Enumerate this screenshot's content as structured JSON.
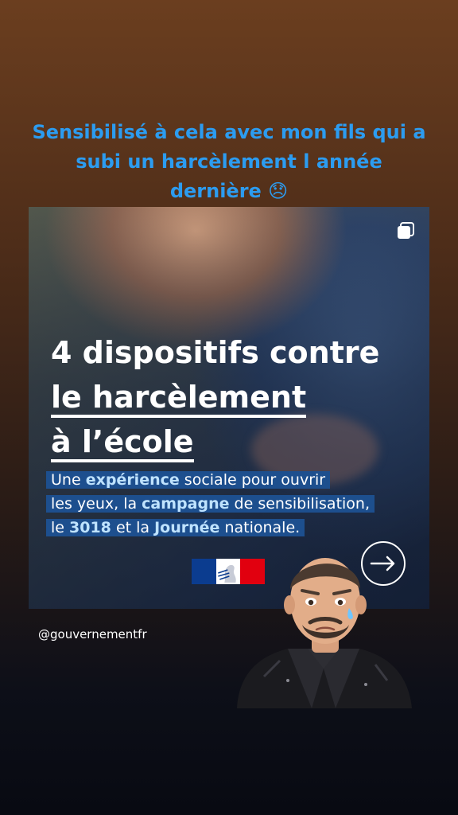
{
  "story": {
    "caption_lines": [
      "Sensibilisé à cela avec mon fils qui a",
      "subi un harcèlement l année",
      "dernière 😞"
    ],
    "mention": "@gouvernementfr"
  },
  "post": {
    "headline": [
      "4 dispositifs contre",
      "le harcèlement",
      "à l’école"
    ],
    "subtext": {
      "line1": {
        "a": "Une ",
        "b": "expérience",
        "c": " sociale pour ouvrir"
      },
      "line2": {
        "a": "les yeux, la ",
        "b": "campagne",
        "c": " de sensibilisation,"
      },
      "line3": {
        "a": "le ",
        "b": "3018",
        "c": " et la ",
        "d": "Journée",
        "e": " nationale."
      }
    },
    "icons": {
      "carousel": "multiple-images-icon",
      "next": "arrow-right-icon",
      "logo": "republique-francaise-flag"
    }
  },
  "sticker": {
    "name": "crying-man-avatar-sticker"
  },
  "colors": {
    "caption": "#2c9cf0",
    "highlight_bg": "#1d4f8e",
    "highlight_text": "#bfe3ff",
    "flag_blue": "#0b3c8f",
    "flag_white": "#ffffff",
    "flag_red": "#e1000f"
  }
}
